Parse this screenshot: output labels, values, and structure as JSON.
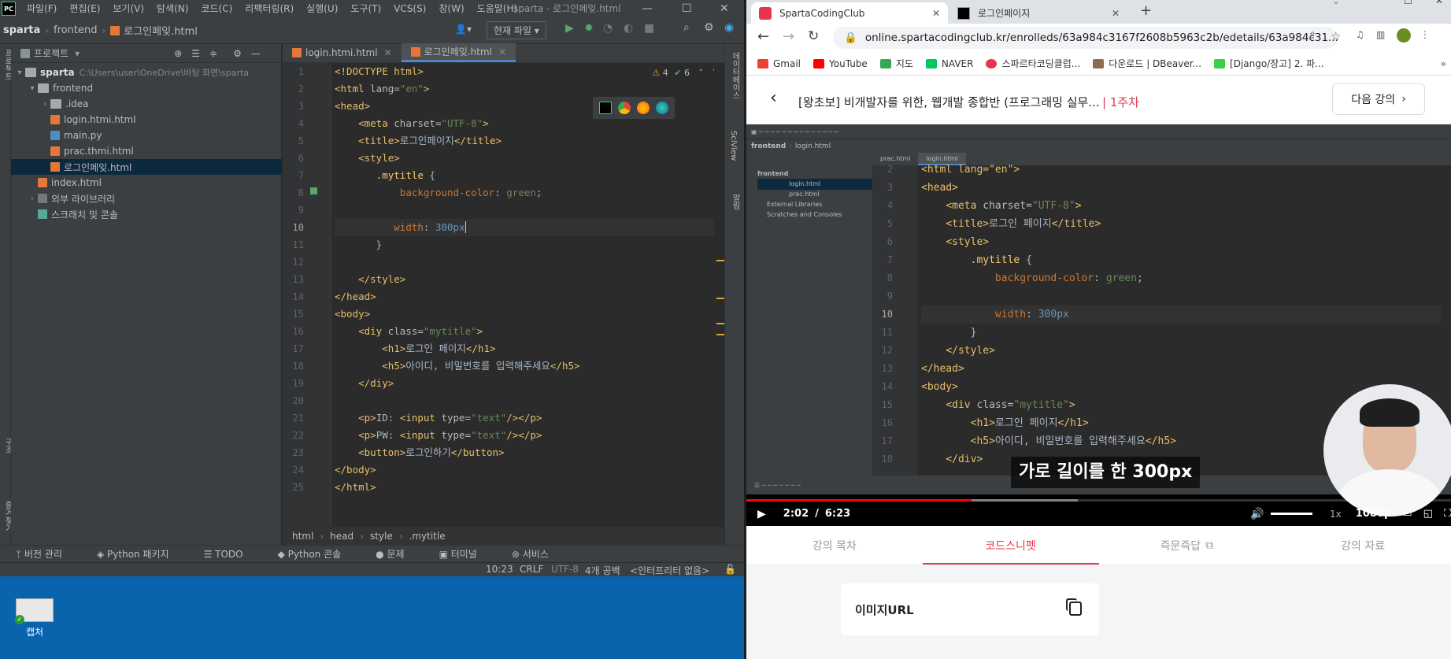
{
  "ide": {
    "menu": [
      "파일(F)",
      "편집(E)",
      "보기(V)",
      "탐색(N)",
      "코드(C)",
      "리팩터링(R)",
      "실행(U)",
      "도구(T)",
      "VCS(S)",
      "창(W)",
      "도움말(H)"
    ],
    "window_title": "sparta - 로그인페잊.html",
    "breadcrumb": [
      "sparta",
      "frontend",
      "로그인페잊.html"
    ],
    "run_config": "현재 파일",
    "project_panel_title": "프로젝트",
    "tree": [
      {
        "label": "sparta",
        "path": "C:\\Users\\user\\OneDrive\\바탕 화면\\sparta"
      },
      {
        "label": "frontend"
      },
      {
        "label": ".idea"
      },
      {
        "label": "login.htmi.html"
      },
      {
        "label": "main.py"
      },
      {
        "label": "prac.thmi.html"
      },
      {
        "label": "로그인페잊.html"
      },
      {
        "label": "index.html"
      },
      {
        "label": "외부 라이브러리"
      },
      {
        "label": "스크래치 및 콘솔"
      }
    ],
    "tabs": [
      "login.htmi.html",
      "로그인페잊.html"
    ],
    "inspections": {
      "warnings": "4",
      "ok": "6"
    },
    "line_numbers": [
      "1",
      "2",
      "3",
      "4",
      "5",
      "6",
      "7",
      "8",
      "9",
      "10",
      "11",
      "12",
      "13",
      "14",
      "15",
      "16",
      "17",
      "18",
      "19",
      "20",
      "21",
      "22",
      "23",
      "24",
      "25"
    ],
    "editor_breadcrumb": [
      "html",
      "head",
      "style",
      ".mytitle"
    ],
    "tool_windows": [
      "버전 관리",
      "Python 패키지",
      "TODO",
      "Python 콘솔",
      "문제",
      "터미널",
      "서비스"
    ],
    "status": {
      "position": "10:23",
      "line_sep": "CRLF",
      "encoding": "UTF-8",
      "indent": "4개 공백",
      "interpreter": "<인터프리터 없음>"
    },
    "left_strip": [
      "프로젝트",
      "구조",
      "즐겨찾기"
    ],
    "right_strip": [
      "데이터베이스",
      "SciView",
      "알림"
    ]
  },
  "desktop": {
    "icon_label": "캡처"
  },
  "browser": {
    "tabs": [
      {
        "title": "SpartaCodingClub"
      },
      {
        "title": "로그인페이지"
      }
    ],
    "url": "online.spartacodingclub.kr/enrolleds/63a984c3167f2608b5963c2b/edetails/63a984c31...",
    "bookmarks": [
      "Gmail",
      "YouTube",
      "지도",
      "NAVER",
      "스파르타코딩클럽...",
      "다운로드 | DBeaver...",
      "[Django/장고] 2. 파..."
    ],
    "lecture_title": "[왕초보] 비개발자를 위한, 웹개발 종합반 (프로그래밍 실무...",
    "week": "1주차",
    "next_button": "다음 강의",
    "video": {
      "current_time": "2:02",
      "separator": "/",
      "duration": "6:23",
      "progress": 0.319,
      "speed": "1x",
      "quality": "1080p",
      "subtitle": "가로 길이를 한 300px",
      "ide_tabs": [
        "prac.html",
        "login.html"
      ],
      "ide_breadcrumb": [
        "frontend",
        "login.html"
      ],
      "ide_tree": [
        "frontend",
        "login.html",
        "prac.html",
        "External Libraries",
        "Scratches and Consoles"
      ],
      "line_numbers": [
        "2",
        "3",
        "4",
        "5",
        "6",
        "7",
        "8",
        "9",
        "10",
        "11",
        "12",
        "13",
        "14",
        "15",
        "16",
        "17",
        "18"
      ]
    },
    "lecture_tabs": [
      "강의 목차",
      "코드스니펫",
      "즉문즉답",
      "강의 자료"
    ],
    "snippet": "이미지URL"
  },
  "colors": {
    "ide_bg": "#2b2b2b",
    "panel": "#3c3f41",
    "accent": "#e8344e",
    "desktop": "#0a64ad"
  }
}
